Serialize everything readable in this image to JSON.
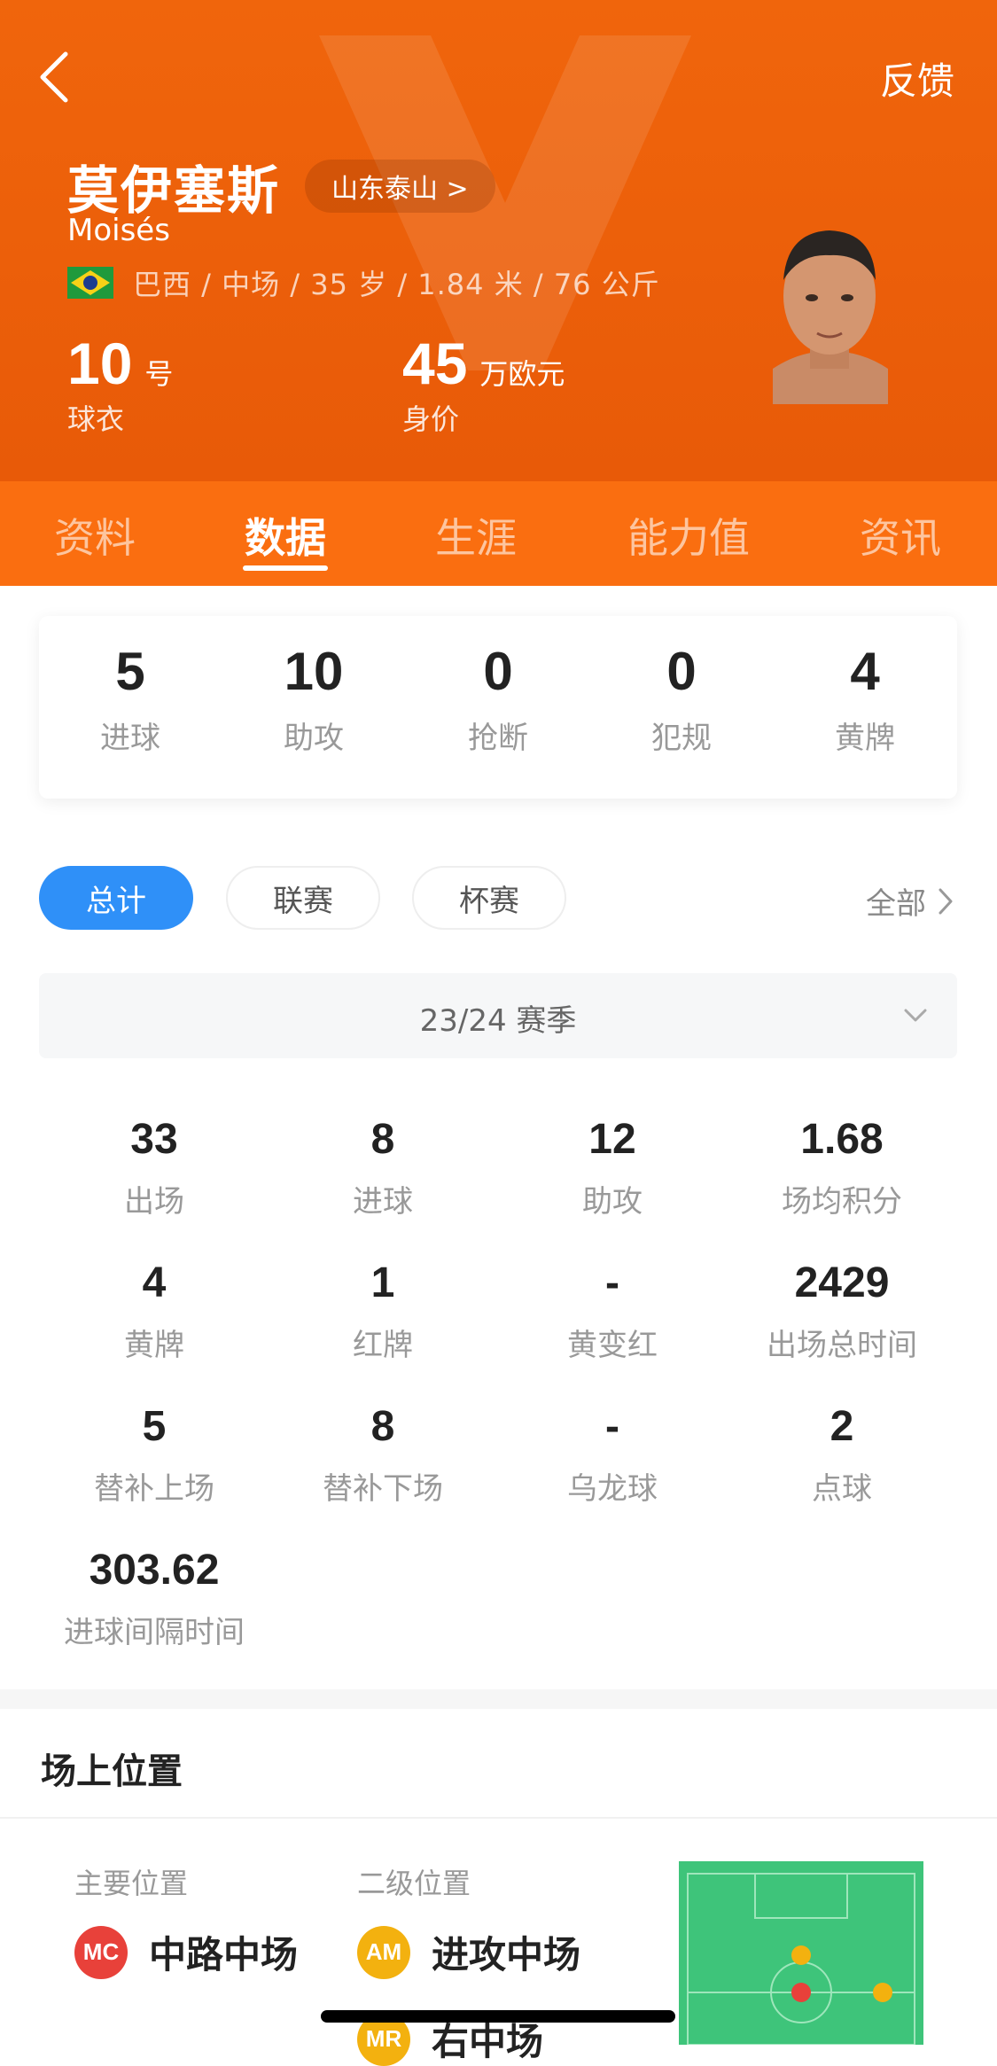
{
  "header": {
    "feedback_label": "反馈",
    "player_name": "莫伊塞斯",
    "club_label": "山东泰山 >",
    "latin_name": "Moisés",
    "bio": "巴西 / 中场 / 35 岁 / 1.84 米 / 76 公斤",
    "jersey_number": "10",
    "jersey_unit": "号",
    "jersey_caption": "球衣",
    "market_value": "45",
    "market_value_unit": "万欧元",
    "market_value_caption": "身价",
    "accent_color": "#f0650c"
  },
  "tabs": [
    "资料",
    "数据",
    "生涯",
    "能力值",
    "资讯"
  ],
  "active_tab": "数据",
  "summary": [
    {
      "value": "5",
      "label": "进球"
    },
    {
      "value": "10",
      "label": "助攻"
    },
    {
      "value": "0",
      "label": "抢断"
    },
    {
      "value": "0",
      "label": "犯规"
    },
    {
      "value": "4",
      "label": "黄牌"
    }
  ],
  "filters": {
    "options": [
      "总计",
      "联赛",
      "杯赛"
    ],
    "selected": "总计",
    "all_label": "全部"
  },
  "season": {
    "selected": "23/24 赛季"
  },
  "stats": [
    {
      "value": "33",
      "label": "出场"
    },
    {
      "value": "8",
      "label": "进球"
    },
    {
      "value": "12",
      "label": "助攻"
    },
    {
      "value": "1.68",
      "label": "场均积分"
    },
    {
      "value": "4",
      "label": "黄牌"
    },
    {
      "value": "1",
      "label": "红牌"
    },
    {
      "value": "-",
      "label": "黄变红"
    },
    {
      "value": "2429",
      "label": "出场总时间"
    },
    {
      "value": "5",
      "label": "替补上场"
    },
    {
      "value": "8",
      "label": "替补下场"
    },
    {
      "value": "-",
      "label": "乌龙球"
    },
    {
      "value": "2",
      "label": "点球"
    },
    {
      "value": "303.62",
      "label": "进球间隔时间"
    }
  ],
  "positions": {
    "section_title": "场上位置",
    "primary_header": "主要位置",
    "secondary_header": "二级位置",
    "primary": [
      {
        "code": "MC",
        "name": "中路中场",
        "color": "#e8413a"
      }
    ],
    "secondary": [
      {
        "code": "AM",
        "name": "进攻中场",
        "color": "#f3b10f"
      },
      {
        "code": "MR",
        "name": "右中场",
        "color": "#f3b10f"
      }
    ],
    "pitch_color": "#3ec47a"
  }
}
